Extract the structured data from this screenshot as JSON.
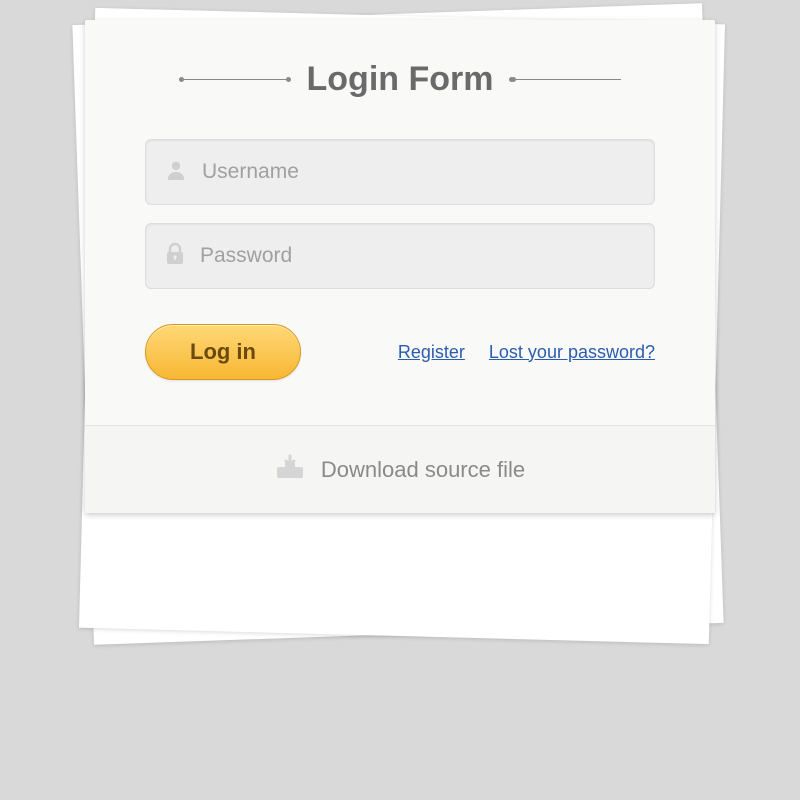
{
  "title": "Login Form",
  "fields": {
    "username_placeholder": "Username",
    "password_placeholder": "Password"
  },
  "actions": {
    "login_label": "Log in",
    "register_label": "Register",
    "lost_password_label": "Lost your password?"
  },
  "footer": {
    "download_label": "Download source file"
  },
  "colors": {
    "accent": "#f7b733",
    "link": "#2a5db0"
  }
}
